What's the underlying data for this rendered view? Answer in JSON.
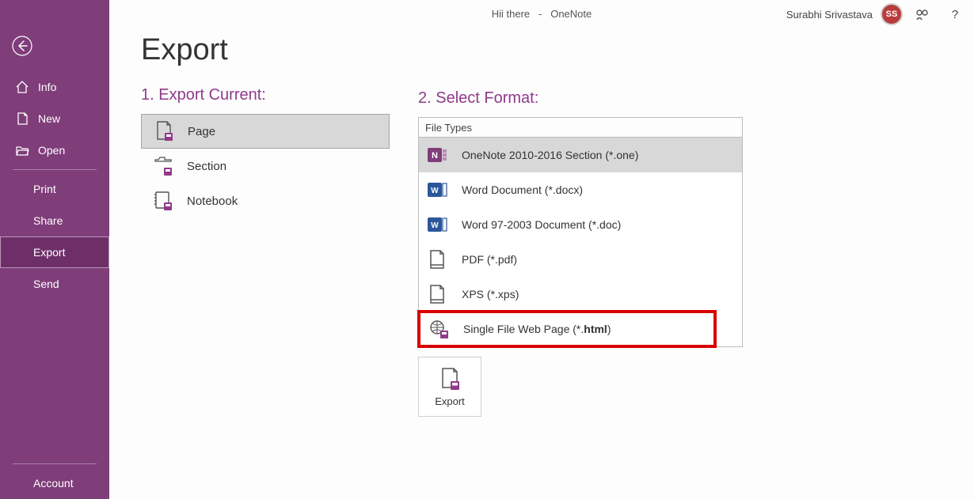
{
  "titlebar": {
    "doc_name": "Hii there",
    "app_name": "OneNote",
    "user_name": "Surabhi Srivastava",
    "user_initials": "SS",
    "help_symbol": "?"
  },
  "sidebar": {
    "back_icon": "back-arrow",
    "items": [
      {
        "icon": "home-icon",
        "label": "Info"
      },
      {
        "icon": "page-icon",
        "label": "New"
      },
      {
        "icon": "folder-icon",
        "label": "Open"
      }
    ],
    "sub_items": [
      {
        "label": "Print"
      },
      {
        "label": "Share"
      },
      {
        "label": "Export",
        "selected": true
      },
      {
        "label": "Send"
      }
    ],
    "account": {
      "label": "Account"
    }
  },
  "page": {
    "title": "Export",
    "col1_heading": "1. Export Current:",
    "col2_heading": "2. Select Format:",
    "ft_header": "File Types",
    "scope_items": [
      {
        "icon": "page-save-icon",
        "label": "Page",
        "selected": true
      },
      {
        "icon": "section-save-icon",
        "label": "Section",
        "selected": false
      },
      {
        "icon": "notebook-save-icon",
        "label": "Notebook",
        "selected": false
      }
    ],
    "file_types": [
      {
        "icon": "onenote-icon",
        "label": "OneNote 2010-2016 Section (*.one)",
        "selected": true
      },
      {
        "icon": "word-icon",
        "label": "Word Document (*.docx)"
      },
      {
        "icon": "word97-icon",
        "label": "Word 97-2003 Document (*.doc)"
      },
      {
        "icon": "pdf-icon",
        "label": "PDF (*.pdf)"
      },
      {
        "icon": "xps-icon",
        "label": "XPS (*.xps)"
      },
      {
        "icon": "html-icon",
        "label_pre": "Single File Web Page (*.",
        "label_bold": "html",
        "label_post": ")",
        "highlight": true
      }
    ],
    "export_button": {
      "label": "Export",
      "icon": "page-save-icon"
    }
  },
  "colors": {
    "accent": "#8f3a8a",
    "sidebar_bg": "#7f3d7a",
    "highlight_red": "#d80000"
  }
}
